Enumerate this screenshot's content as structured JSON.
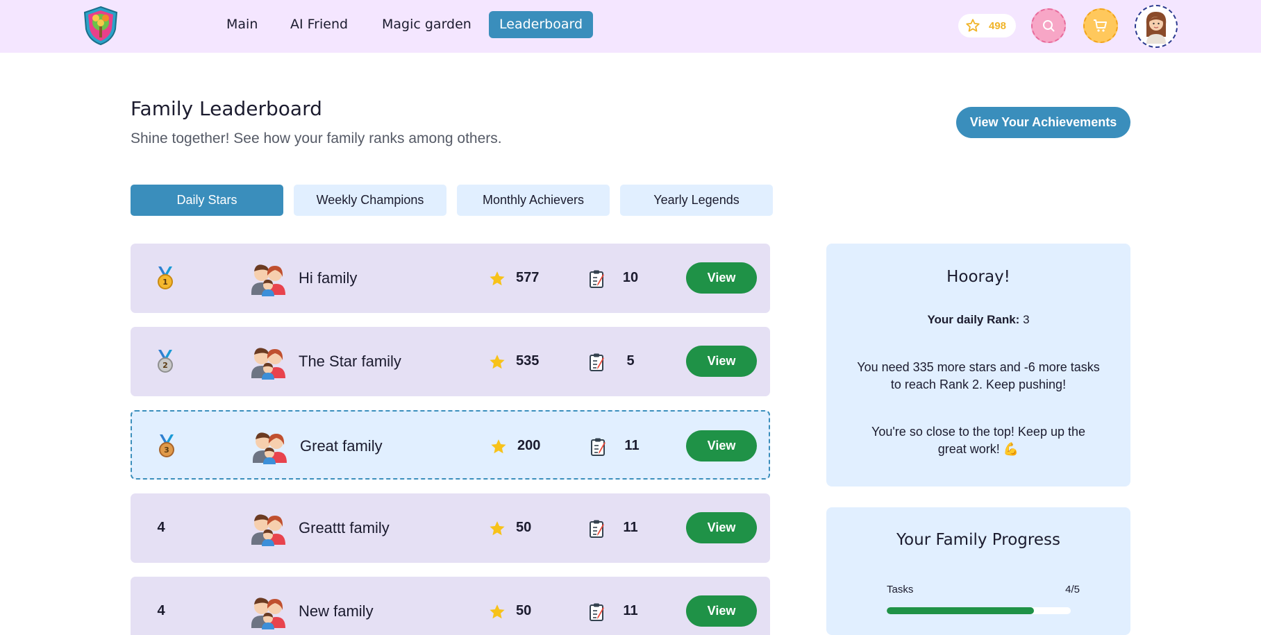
{
  "nav": {
    "items": [
      {
        "label": "Main",
        "active": false
      },
      {
        "label": "AI Friend",
        "active": false
      },
      {
        "label": "Magic garden",
        "active": false
      },
      {
        "label": "Leaderboard",
        "active": true
      }
    ],
    "stars_count": "498"
  },
  "page": {
    "title": "Family Leaderboard",
    "subtitle": "Shine together! See how your family ranks among others.",
    "achievements_button": "View Your Achievements"
  },
  "tabs": [
    {
      "label": "Daily Stars",
      "active": true
    },
    {
      "label": "Weekly Champions",
      "active": false
    },
    {
      "label": "Monthly Achievers",
      "active": false
    },
    {
      "label": "Yearly Legends",
      "active": false
    }
  ],
  "rows": [
    {
      "rank": "1",
      "medal": "gold",
      "name": "Hi family",
      "stars": "577",
      "tasks": "10",
      "view": "View",
      "mine": false
    },
    {
      "rank": "2",
      "medal": "silver",
      "name": "The Star family",
      "stars": "535",
      "tasks": "5",
      "view": "View",
      "mine": false
    },
    {
      "rank": "3",
      "medal": "bronze",
      "name": "Great family",
      "stars": "200",
      "tasks": "11",
      "view": "View",
      "mine": true
    },
    {
      "rank": "4",
      "medal": "",
      "name": "Greattt family",
      "stars": "50",
      "tasks": "11",
      "view": "View",
      "mine": false
    },
    {
      "rank": "4",
      "medal": "",
      "name": "New family",
      "stars": "50",
      "tasks": "11",
      "view": "View",
      "mine": false
    }
  ],
  "hooray": {
    "title": "Hooray!",
    "rank_label": "Your daily Rank:",
    "rank_value": "3",
    "need_text": "You need 335 more stars and -6 more tasks to reach Rank 2. Keep pushing!",
    "close_text": "You're so close to the top! Keep up the great work! 💪"
  },
  "progress": {
    "title": "Your Family Progress",
    "tasks_label": "Tasks",
    "tasks_value": "4/5",
    "tasks_fraction": 0.8
  },
  "colors": {
    "header_bg": "#f4e6ff",
    "accent": "#3a8ebc",
    "row_bg": "#e5e0f4",
    "card_bg": "#e1efff",
    "view_green": "#1f9247",
    "star_gold": "#f0b429"
  },
  "icons": {
    "logo": "tree-shield-logo",
    "star": "star-icon",
    "search": "search-icon",
    "cart": "cart-icon",
    "avatar": "user-avatar",
    "family": "family-icon",
    "tasks": "clipboard-icon",
    "medal": "medal-icon"
  }
}
